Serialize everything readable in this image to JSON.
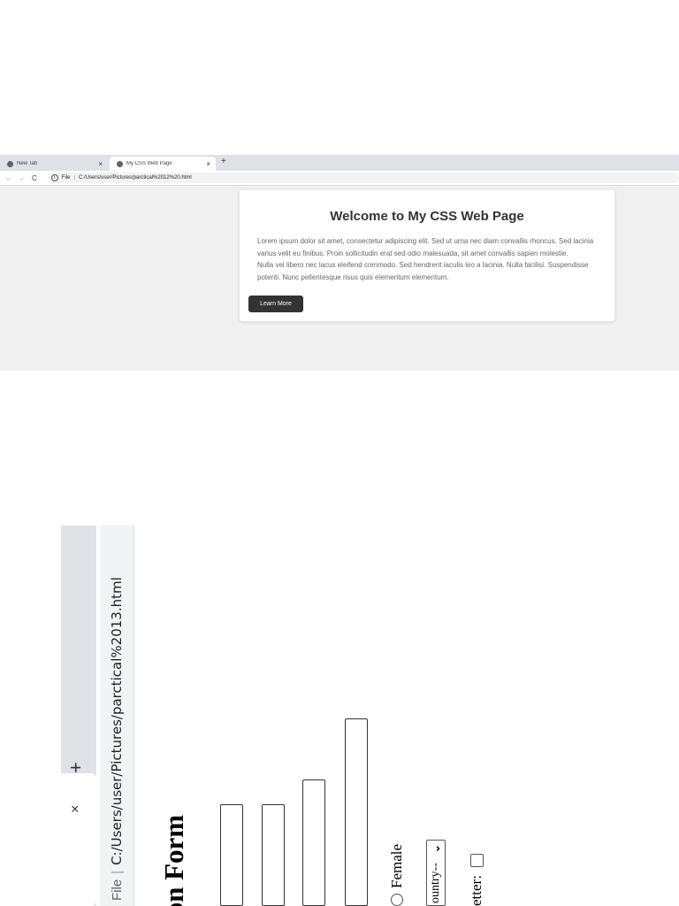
{
  "browser1": {
    "tabs": [
      {
        "title": "New Tab",
        "close": "×"
      },
      {
        "title": "My CSS Web Page",
        "close": "×"
      }
    ],
    "new_tab": "+",
    "nav": {
      "back": "←",
      "forward": "→",
      "reload": "C"
    },
    "address": {
      "info": "i",
      "file_label": "File",
      "separator": "|",
      "url": "C:/Users/user/Pictures/parctical%2012%20.html"
    }
  },
  "page1": {
    "title": "Welcome to My CSS Web Page",
    "paragraph1": "Lorem ipsum dolor sit amet, consectetur adipiscing elit. Sed ut urna nec diam convallis rhoncus. Sed lacinia varius velit eu finibus. Proin sollicitudin erat sed odio malesuada, sit amet convallis sapien molestie.",
    "paragraph2": "Nulla vel libero nec lacus eleifend commodo. Sed hendrerit iaculis leo a lacinia. Nulla facilisi. Suspendisse potenti. Nunc pellentesque risus quis elementum elementum.",
    "button": "Learn More"
  },
  "browser2": {
    "tab_close": "×",
    "new_tab": "+",
    "address": {
      "file_label": "File",
      "separator": "|",
      "url": "C:/Users/user/Pictures/parctical%2013.html"
    }
  },
  "page2": {
    "heading": "ion Form",
    "gender_option": "Female",
    "country_select": "ountry--",
    "select_chevron": "⌄",
    "newsletter_label": "etter:"
  }
}
